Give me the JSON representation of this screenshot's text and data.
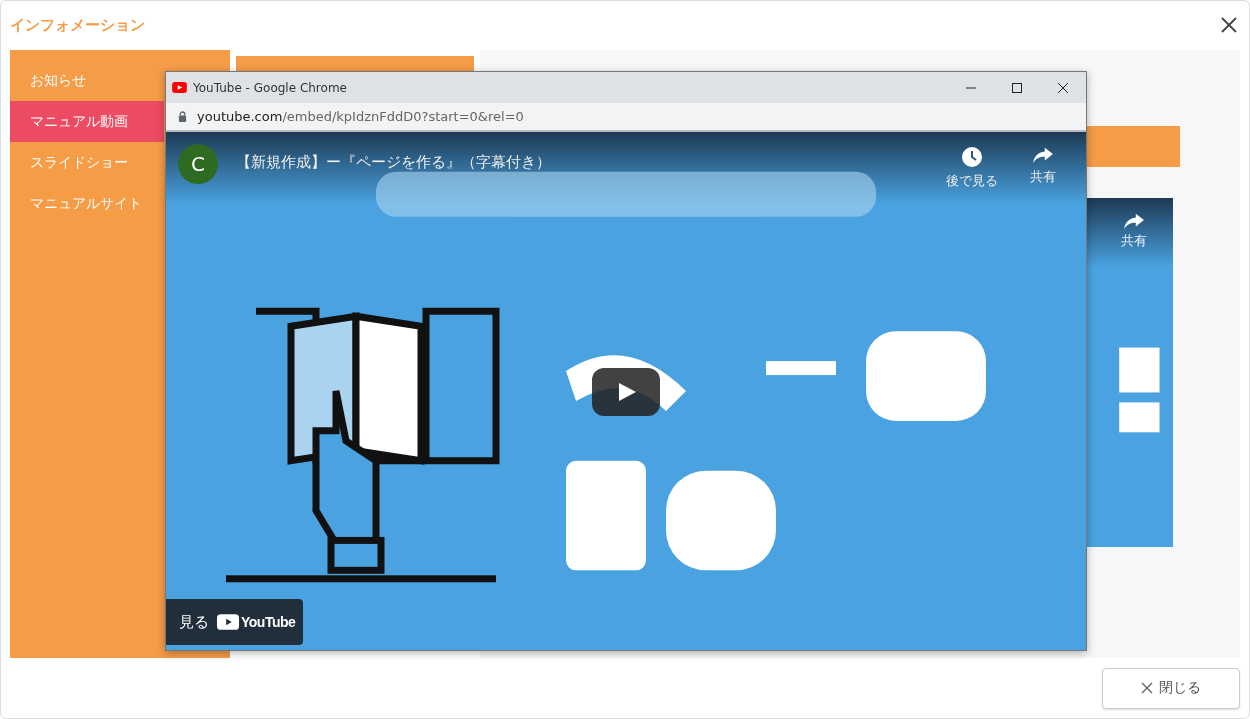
{
  "dialog": {
    "title": "インフォメーション",
    "close_label": "閉じる"
  },
  "sidebar": {
    "items": [
      {
        "label": "お知らせ",
        "selected": false
      },
      {
        "label": "マニュアル動画",
        "selected": true
      },
      {
        "label": "スライドショー",
        "selected": false
      },
      {
        "label": "マニュアルサイト",
        "selected": false
      }
    ]
  },
  "background_video": {
    "share_label": "共有"
  },
  "popup": {
    "window_title": "YouTube - Google Chrome",
    "url_host": "youtube.com",
    "url_path": "/embed/kpIdznFddD0?start=0&rel=0",
    "video": {
      "channel_initial": "C",
      "title": "【新規作成】ー『ページを作る』（字幕付き）",
      "watch_later": "後で見る",
      "share": "共有",
      "watch_on": "見る",
      "youtube_logo": "YouTube"
    }
  }
}
